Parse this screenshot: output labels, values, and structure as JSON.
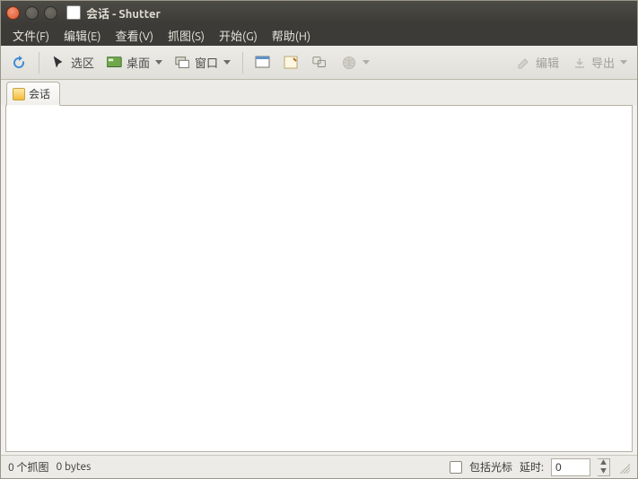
{
  "window": {
    "title": "会话 - Shutter"
  },
  "menubar": {
    "file": "文件(F)",
    "edit": "编辑(E)",
    "view": "查看(V)",
    "capture": "抓图(S)",
    "go": "开始(G)",
    "help": "帮助(H)"
  },
  "toolbar": {
    "selection": "选区",
    "desktop": "桌面",
    "window_btn": "窗口",
    "edit_btn": "编辑",
    "export_btn": "导出"
  },
  "tabs": {
    "session": "会话"
  },
  "status": {
    "count": "0 个抓图",
    "size": "0 bytes",
    "include_cursor": "包括光标",
    "delay_label": "延时:",
    "delay_value": "0"
  }
}
